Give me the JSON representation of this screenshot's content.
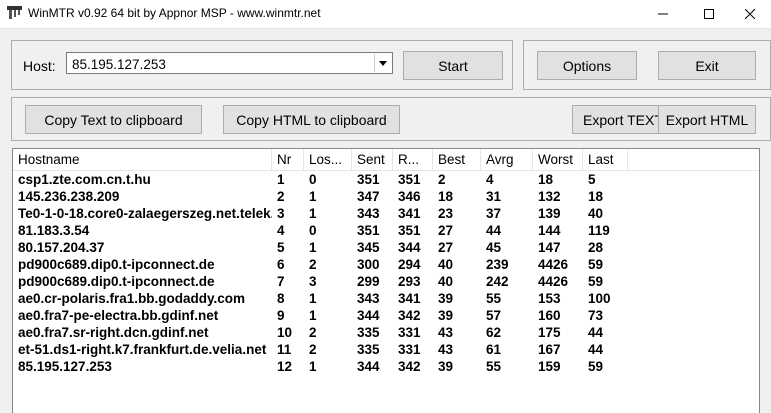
{
  "window": {
    "title": "WinMTR v0.92 64 bit by Appnor MSP - www.winmtr.net",
    "minimize": "—",
    "maximize": "☐",
    "close": "✕"
  },
  "toolbar": {
    "host_label": "Host:",
    "host_value": "85.195.127.253",
    "start_label": "Start",
    "options_label": "Options",
    "exit_label": "Exit"
  },
  "export": {
    "copy_text_label": "Copy Text to clipboard",
    "copy_html_label": "Copy HTML to clipboard",
    "export_text_label": "Export TEXT",
    "export_html_label": "Export HTML"
  },
  "table": {
    "columns": [
      "Hostname",
      "Nr",
      "Loss %",
      "Sent",
      "Recv",
      "Best",
      "Avrg",
      "Worst",
      "Last"
    ],
    "columns_display": [
      "Hostname",
      "Nr",
      "Los...",
      "Sent",
      "R...",
      "Best",
      "Avrg",
      "Worst",
      "Last"
    ],
    "rows": [
      [
        "csp1.zte.com.cn.t.hu",
        "1",
        "0",
        "351",
        "351",
        "2",
        "4",
        "18",
        "5"
      ],
      [
        "145.236.238.209",
        "2",
        "1",
        "347",
        "346",
        "18",
        "31",
        "132",
        "18"
      ],
      [
        "Te0-1-0-18.core0-zalaegerszeg.net.telek...",
        "3",
        "1",
        "343",
        "341",
        "23",
        "37",
        "139",
        "40"
      ],
      [
        "81.183.3.54",
        "4",
        "0",
        "351",
        "351",
        "27",
        "44",
        "144",
        "119"
      ],
      [
        "80.157.204.37",
        "5",
        "1",
        "345",
        "344",
        "27",
        "45",
        "147",
        "28"
      ],
      [
        "pd900c689.dip0.t-ipconnect.de",
        "6",
        "2",
        "300",
        "294",
        "40",
        "239",
        "4426",
        "59"
      ],
      [
        "pd900c689.dip0.t-ipconnect.de",
        "7",
        "3",
        "299",
        "293",
        "40",
        "242",
        "4426",
        "59"
      ],
      [
        "ae0.cr-polaris.fra1.bb.godaddy.com",
        "8",
        "1",
        "343",
        "341",
        "39",
        "55",
        "153",
        "100"
      ],
      [
        "ae0.fra7-pe-electra.bb.gdinf.net",
        "9",
        "1",
        "344",
        "342",
        "39",
        "57",
        "160",
        "73"
      ],
      [
        "ae0.fra7.sr-right.dcn.gdinf.net",
        "10",
        "2",
        "335",
        "331",
        "43",
        "62",
        "175",
        "44"
      ],
      [
        "et-51.ds1-right.k7.frankfurt.de.velia.net",
        "11",
        "2",
        "335",
        "331",
        "43",
        "61",
        "167",
        "44"
      ],
      [
        "85.195.127.253",
        "12",
        "1",
        "344",
        "342",
        "39",
        "55",
        "159",
        "59"
      ]
    ]
  }
}
